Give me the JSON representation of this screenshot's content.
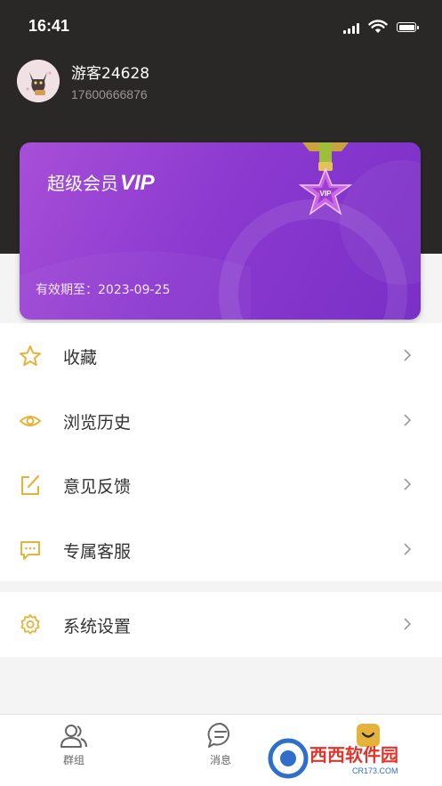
{
  "status_bar": {
    "time": "16:41"
  },
  "profile": {
    "username": "游客24628",
    "phone": "17600666876"
  },
  "vip_card": {
    "title": "超级会员",
    "title_emphasis": "VIP",
    "medal_text": "VIP",
    "expiry": "有效期至：2023-09-25"
  },
  "menu": {
    "items": [
      {
        "label": "收藏",
        "icon": "star-icon"
      },
      {
        "label": "浏览历史",
        "icon": "eye-icon"
      },
      {
        "label": "意见反馈",
        "icon": "edit-icon"
      },
      {
        "label": "专属客服",
        "icon": "chat-icon"
      }
    ],
    "settings": {
      "label": "系统设置",
      "icon": "gear-icon"
    }
  },
  "tabbar": {
    "tabs": [
      {
        "label": "群组",
        "icon": "group-icon"
      },
      {
        "label": "消息",
        "icon": "message-icon"
      }
    ]
  },
  "watermark": {
    "text": "西西软件园",
    "url": "CR173.COM"
  },
  "colors": {
    "accent": "#e6b33a",
    "header_bg": "#2a2727",
    "vip_purple": "#8c3ad0"
  }
}
